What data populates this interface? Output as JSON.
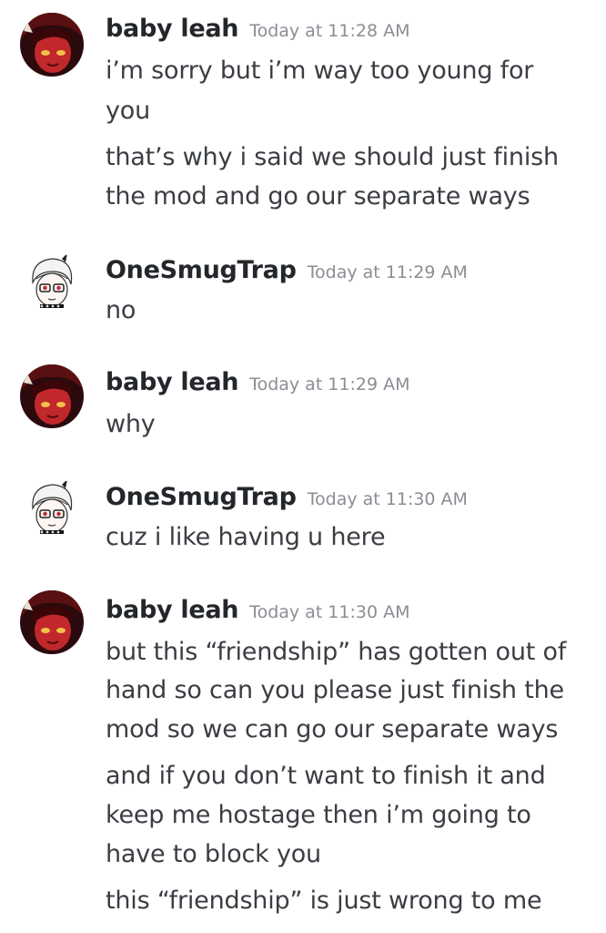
{
  "messages": [
    {
      "author": "baby leah",
      "time": "Today at 11:28 AM",
      "avatar": "red-anime-girl-avatar",
      "lines": [
        "i’m sorry but i’m way too young for",
        "you",
        "that’s why i said we should just finish",
        "the mod and go our separate ways"
      ]
    },
    {
      "author": "OneSmugTrap",
      "time": "Today at 11:29 AM",
      "avatar": "white-haired-glasses-avatar",
      "lines": [
        "no"
      ]
    },
    {
      "author": "baby leah",
      "time": "Today at 11:29 AM",
      "avatar": "red-anime-girl-avatar",
      "lines": [
        "why"
      ]
    },
    {
      "author": "OneSmugTrap",
      "time": "Today at 11:30 AM",
      "avatar": "white-haired-glasses-avatar",
      "lines": [
        "cuz i like having u here"
      ]
    },
    {
      "author": "baby leah",
      "time": "Today at 11:30 AM",
      "avatar": "red-anime-girl-avatar",
      "lines": [
        "but this “friendship” has gotten out of",
        "hand so can you please just finish the",
        "mod so we can go our separate ways",
        "and if you don’t want to finish it and",
        "keep me hostage then i’m going to",
        "have to block you",
        "this “friendship” is just wrong to me"
      ]
    }
  ],
  "colors": {
    "username": "#23262a",
    "timestamp": "#8a8e94",
    "text": "#3a3e43",
    "background": "#ffffff"
  }
}
